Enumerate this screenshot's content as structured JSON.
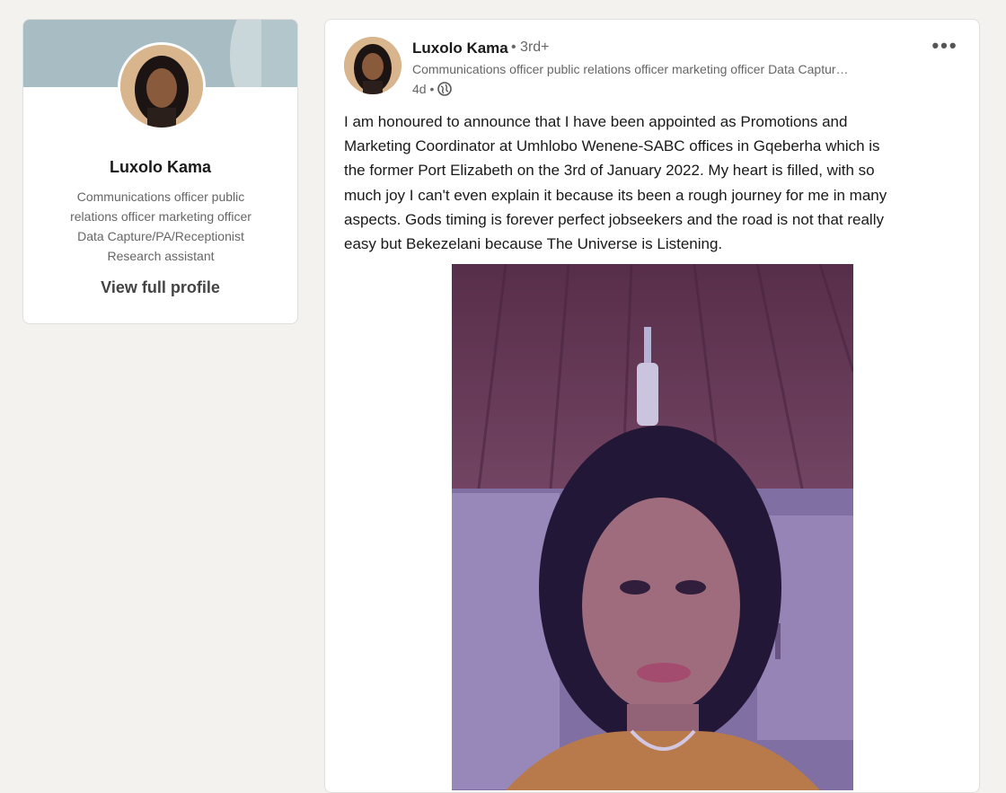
{
  "profile_card": {
    "name": "Luxolo Kama",
    "headline_lines": [
      "Communications officer public",
      "relations officer marketing officer",
      "Data Capture/PA/Receptionist",
      "Research assistant"
    ],
    "view_profile_label": "View full profile"
  },
  "post": {
    "author": "Luxolo Kama",
    "degree": "• 3rd+",
    "headline": "Communications officer public relations officer marketing officer Data Captur…",
    "time": "4d •",
    "visibility_icon": "globe-icon",
    "more_label": "•••",
    "text_lines": [
      "I am honoured to announce that I have been appointed as Promotions and",
      "Marketing Coordinator at Umhlobo Wenene-SABC offices in Gqeberha which is",
      "the former Port Elizabeth on the 3rd of January 2022. My heart is filled, with so",
      "much joy I can't even explain it because its been a rough journey for me in many",
      "aspects. Gods timing is forever perfect jobseekers and the road is not that really",
      "easy but Bekezelani because The Universe is Listening."
    ]
  },
  "colors": {
    "page_bg": "#f3f2ef",
    "card_bg": "#ffffff",
    "banner": "#a7bcc3",
    "muted_text": "#666666"
  }
}
